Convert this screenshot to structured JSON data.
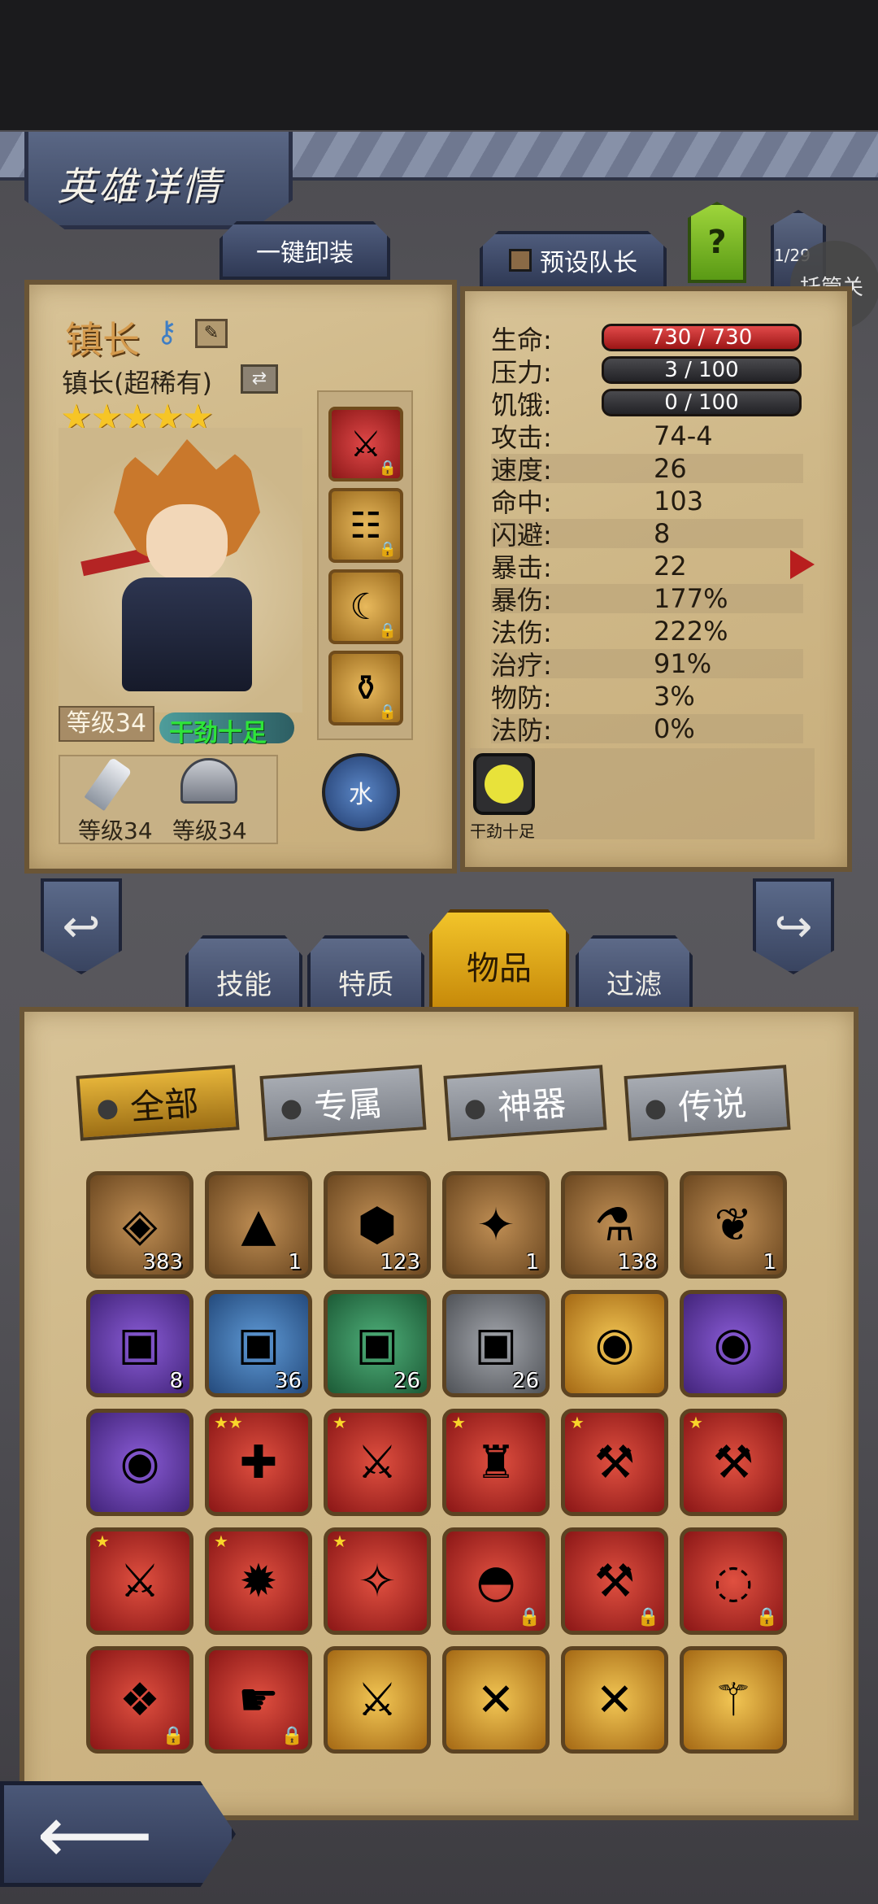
{
  "header": {
    "title": "英雄详情"
  },
  "top_buttons": {
    "unequip_all": "一键卸装",
    "preset_leader": "预设队长",
    "help": "?",
    "page_counter": "1/29",
    "auto": "托管关"
  },
  "hero": {
    "name": "镇长",
    "class_name": "镇长(超稀有)",
    "stars": "★★★★★",
    "level": "等级34",
    "status": "干劲十足",
    "weapon_level": "等级34",
    "armor_level": "等级34",
    "element": "水",
    "slots": [
      {
        "icon": "spear-icon",
        "glyph": "⚔",
        "frame": "red"
      },
      {
        "icon": "chest-icon",
        "glyph": "☷",
        "frame": "gold"
      },
      {
        "icon": "claw-icon",
        "glyph": "☾",
        "frame": "gold"
      },
      {
        "icon": "pouch-icon",
        "glyph": "⚱",
        "frame": "gold"
      }
    ]
  },
  "stats": {
    "hp": {
      "label": "生命:",
      "value": "730 / 730"
    },
    "stress": {
      "label": "压力:",
      "value": "3 / 100"
    },
    "hunger": {
      "label": "饥饿:",
      "value": "0 / 100"
    },
    "rows": [
      {
        "label": "攻击:",
        "value": "74-4"
      },
      {
        "label": "速度:",
        "value": "26"
      },
      {
        "label": "命中:",
        "value": "103"
      },
      {
        "label": "闪避:",
        "value": "8"
      },
      {
        "label": "暴击:",
        "value": "22"
      },
      {
        "label": "暴伤:",
        "value": "177%"
      },
      {
        "label": "法伤:",
        "value": "222%"
      },
      {
        "label": "治疗:",
        "value": "91%"
      },
      {
        "label": "物防:",
        "value": "3%"
      },
      {
        "label": "法防:",
        "value": "0%"
      }
    ],
    "trait_label": "干劲十足"
  },
  "tabs": [
    "技能",
    "特质",
    "物品",
    "过滤"
  ],
  "filters": [
    "全部",
    "专属",
    "神器",
    "传说"
  ],
  "items": [
    {
      "frame": "brown",
      "glyph": "◈",
      "count": "383"
    },
    {
      "frame": "brown",
      "glyph": "▲",
      "count": "1"
    },
    {
      "frame": "brown",
      "glyph": "⬢",
      "count": "123"
    },
    {
      "frame": "brown",
      "glyph": "✦",
      "count": "1"
    },
    {
      "frame": "brown",
      "glyph": "⚗",
      "count": "138"
    },
    {
      "frame": "brown",
      "glyph": "❦",
      "count": "1"
    },
    {
      "frame": "purple",
      "glyph": "▣",
      "count": "8"
    },
    {
      "frame": "blue",
      "glyph": "▣",
      "count": "36"
    },
    {
      "frame": "green",
      "glyph": "▣",
      "count": "26"
    },
    {
      "frame": "gray",
      "glyph": "▣",
      "count": "26"
    },
    {
      "frame": "gold",
      "glyph": "◉",
      "count": ""
    },
    {
      "frame": "purple",
      "glyph": "◉",
      "count": ""
    },
    {
      "frame": "purple",
      "glyph": "◉",
      "count": ""
    },
    {
      "frame": "red",
      "glyph": "✚",
      "count": ""
    },
    {
      "frame": "red",
      "glyph": "⚔",
      "count": ""
    },
    {
      "frame": "red",
      "glyph": "♜",
      "count": ""
    },
    {
      "frame": "red",
      "glyph": "⚒",
      "count": ""
    },
    {
      "frame": "red",
      "glyph": "⚒",
      "count": ""
    },
    {
      "frame": "red",
      "glyph": "⚔",
      "count": ""
    },
    {
      "frame": "red",
      "glyph": "✹",
      "count": ""
    },
    {
      "frame": "red",
      "glyph": "✧",
      "count": ""
    },
    {
      "frame": "red",
      "glyph": "◓",
      "count": ""
    },
    {
      "frame": "red",
      "glyph": "⚒",
      "count": ""
    },
    {
      "frame": "red",
      "glyph": "◌",
      "count": ""
    },
    {
      "frame": "red",
      "glyph": "❖",
      "count": ""
    },
    {
      "frame": "red",
      "glyph": "☛",
      "count": ""
    },
    {
      "frame": "gold",
      "glyph": "⚔",
      "count": ""
    },
    {
      "frame": "gold",
      "glyph": "✕",
      "count": ""
    },
    {
      "frame": "gold",
      "glyph": "✕",
      "count": ""
    },
    {
      "frame": "gold",
      "glyph": "⚚",
      "count": ""
    }
  ]
}
